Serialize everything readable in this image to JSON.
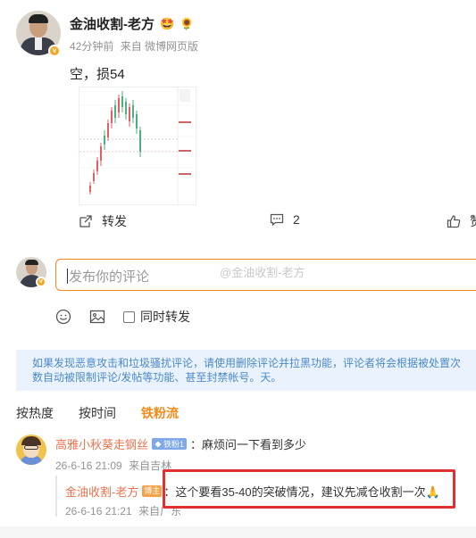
{
  "post": {
    "author": "金油收割-老方",
    "author_emojis": [
      "🤩",
      "🌻"
    ],
    "time_ago": "42分钟前",
    "source": "来自 微博网页版",
    "text": "空，损54"
  },
  "actions": {
    "repost_label": "转发",
    "comment_count": "2",
    "like_label": "赞"
  },
  "comment_box": {
    "placeholder": "发布你的评论",
    "watermark": "@金油收割-老方",
    "repost_option": "同时转发"
  },
  "notice": "如果发现恶意攻击和垃圾骚扰评论，请使用删除评论并拉黑功能，评论者将会根据被处置次数自动被限制评论/发帖等功能、甚至封禁帐号。天。",
  "sort_tabs": {
    "hot": "按热度",
    "time": "按时间",
    "fans": "铁粉流"
  },
  "comment": {
    "user": "高雅小秋葵走钢丝",
    "fan_badge": "铁粉1",
    "text": "：麻烦问一下看到多少",
    "time": "26-6-16 21:09",
    "source": "来自吉林"
  },
  "reply": {
    "user": "金油收割-老方",
    "badge": "博主",
    "text": "：这个要看35-40的突破情况，建议先减仓收割一次🙏",
    "time": "26-6-16 21:21",
    "source": "来自广东"
  },
  "colors": {
    "accent": "#f38a19",
    "username": "#eb7350",
    "notice_bg": "#eaf3fd",
    "notice_text": "#4b89c9",
    "highlight_border": "#e03131"
  }
}
